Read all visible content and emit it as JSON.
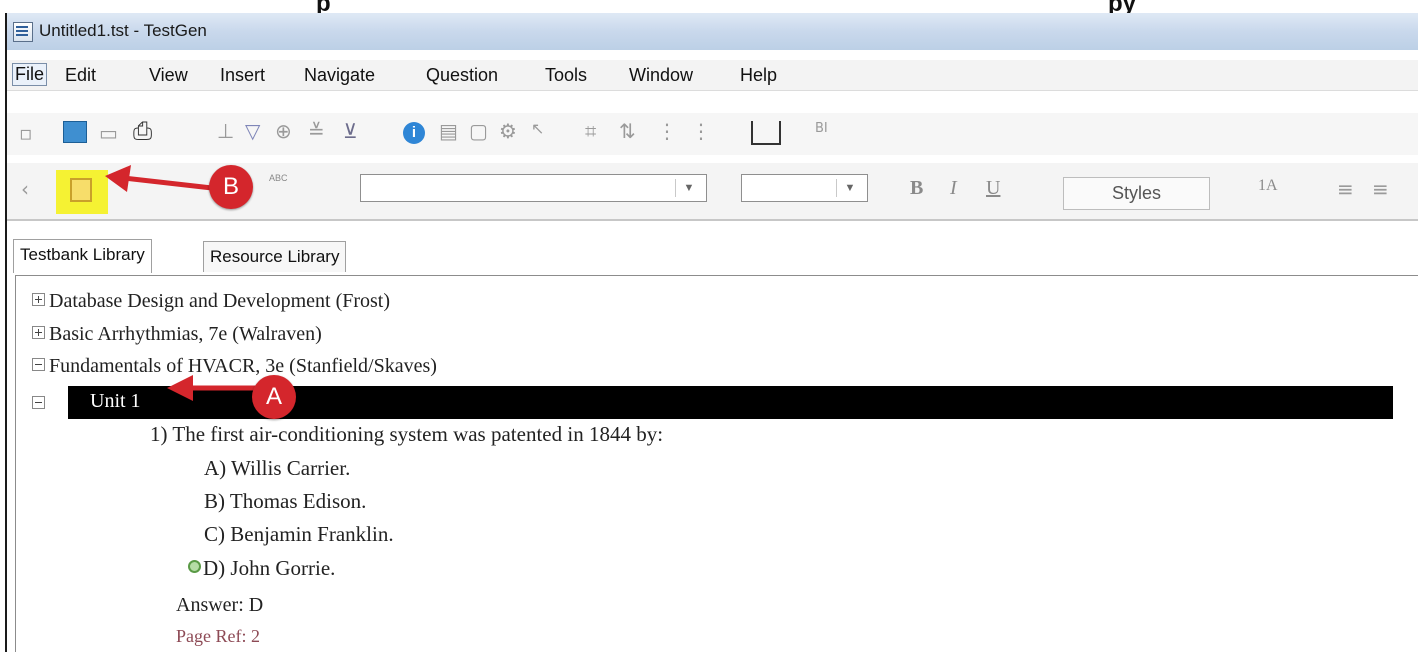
{
  "top_caption": {
    "left": "p",
    "right": "py"
  },
  "window": {
    "title": "Untitled1.tst - TestGen"
  },
  "menu": [
    "File",
    "Edit",
    "View",
    "Insert",
    "Navigate",
    "Question",
    "Tools",
    "Window",
    "Help"
  ],
  "toolbar2": {
    "spell_label": "ABC",
    "styles_label": "Styles",
    "bold": "B",
    "italic": "I",
    "underline": "U",
    "font_size_label": "1A"
  },
  "tabs": [
    "Testbank Library",
    "Resource Library"
  ],
  "tree": [
    {
      "label": "Database Design and Development (Frost)",
      "expanded": false
    },
    {
      "label": "Basic Arrhythmias, 7e (Walraven)",
      "expanded": false
    },
    {
      "label": "Fundamentals of HVACR, 3e (Stanfield/Skaves)",
      "expanded": true
    }
  ],
  "unit": {
    "label": "Unit 1",
    "expanded": true
  },
  "question": {
    "number": "1)",
    "text": "The first air-conditioning system was patented in 1844 by:",
    "choices": [
      "A) Willis Carrier.",
      "B) Thomas Edison.",
      "C) Benjamin Franklin.",
      "D) John Gorrie."
    ],
    "correct_index": 3,
    "answer": "Answer:  D",
    "page_ref": "Page Ref: 2"
  },
  "annotations": {
    "a": "A",
    "b": "B",
    "color": "#d4262c",
    "highlight": "#f5f233"
  }
}
